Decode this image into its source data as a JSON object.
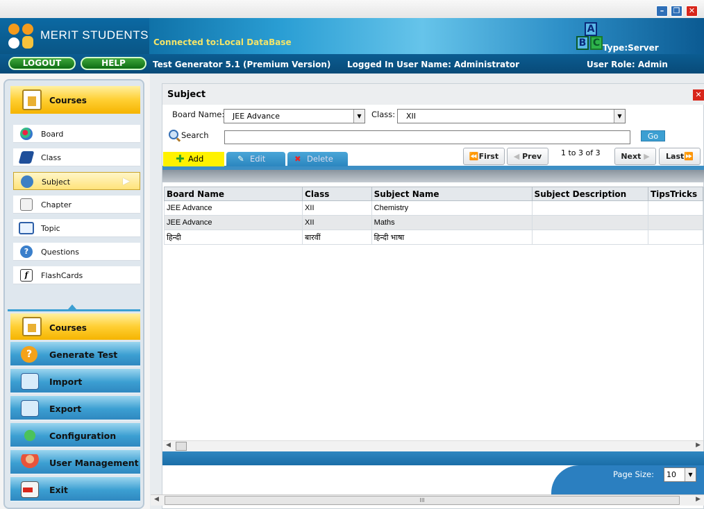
{
  "header": {
    "app_name": "MERIT STUDENTS",
    "connection": "Connected to:Local DataBase",
    "server_type": "Type:Server",
    "logout_label": "LOGOUT",
    "help_label": "HELP",
    "version": "Test Generator 5.1 (Premium Version)",
    "user": "Logged In User Name:  Administrator",
    "role": "User Role: Admin"
  },
  "sidebar": {
    "top_section": "Courses",
    "items": [
      {
        "label": "Board",
        "icon": "board-icon"
      },
      {
        "label": "Class",
        "icon": "class-icon"
      },
      {
        "label": "Subject",
        "icon": "subject-icon",
        "selected": true
      },
      {
        "label": "Chapter",
        "icon": "chapter-icon"
      },
      {
        "label": "Topic",
        "icon": "topic-icon"
      },
      {
        "label": "Questions",
        "icon": "questions-icon"
      },
      {
        "label": "FlashCards",
        "icon": "flashcards-icon"
      }
    ],
    "modules": [
      {
        "label": "Courses"
      },
      {
        "label": "Generate Test"
      },
      {
        "label": "Import"
      },
      {
        "label": "Export"
      },
      {
        "label": "Configuration"
      },
      {
        "label": "User Management"
      },
      {
        "label": "Exit"
      }
    ]
  },
  "main": {
    "title": "Subject",
    "board_label": "Board Name:",
    "board_value": "JEE Advance",
    "class_label": "Class:",
    "class_value": "XII",
    "search_label": "Search",
    "search_value": "",
    "go_label": "Go",
    "add_label": "Add",
    "edit_label": "Edit",
    "delete_label": "Delete",
    "first_label": "First",
    "prev_label": "Prev",
    "page_info": "1 to 3 of 3",
    "next_label": "Next",
    "last_label": "Last",
    "columns": [
      "Board Name",
      "Class",
      "Subject Name",
      "Subject Description",
      "TipsTricks"
    ],
    "rows": [
      [
        "JEE Advance",
        "XII",
        "Chemistry",
        "",
        ""
      ],
      [
        "JEE Advance",
        "XII",
        "Maths",
        "",
        ""
      ],
      [
        "हिन्दी",
        "बारवीं",
        "हिन्दी भाषा",
        "",
        ""
      ]
    ],
    "page_size_label": "Page Size:",
    "page_size_value": "10"
  },
  "colors": {
    "accent_yellow": "#ffcf33",
    "header_blue": "#0b5c91",
    "close_red": "#d8261b"
  }
}
